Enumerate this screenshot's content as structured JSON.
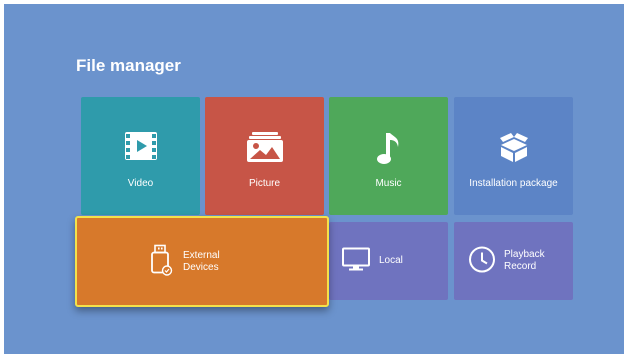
{
  "page": {
    "title": "File manager"
  },
  "tiles": {
    "video": {
      "label": "Video",
      "icon": "film-play-icon"
    },
    "picture": {
      "label": "Picture",
      "icon": "picture-icon"
    },
    "music": {
      "label": "Music",
      "icon": "music-note-icon"
    },
    "installation": {
      "label": "Installation package",
      "icon": "package-box-icon"
    },
    "external": {
      "line1": "External",
      "line2": "Devices",
      "icon": "usb-drive-icon"
    },
    "local": {
      "label": "Local",
      "icon": "monitor-icon"
    },
    "playback": {
      "line1": "Playback",
      "line2": "Record",
      "icon": "clock-icon"
    }
  },
  "colors": {
    "background": "#6b93cd",
    "video": "#2f9bab",
    "picture": "#c75547",
    "music": "#4fa85a",
    "installation": "#5c84c6",
    "external": "#d7792b",
    "focus_border": "#f3e24a",
    "local": "#6f73bf",
    "playback": "#6f73bf"
  }
}
